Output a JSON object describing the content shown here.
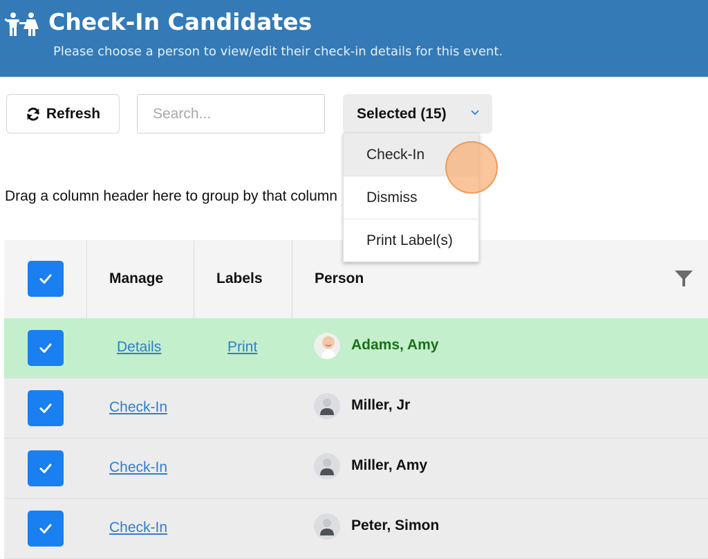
{
  "header": {
    "icon": "people-icon",
    "title": "Check-In Candidates",
    "subtitle": "Please choose a person to view/edit their check-in details for this event."
  },
  "toolbar": {
    "refresh_label": "Refresh",
    "refresh_icon": "refresh-icon",
    "search_placeholder": "Search...",
    "search_value": "",
    "selected_label": "Selected (15)",
    "selected_count": 15
  },
  "dropdown_menu": {
    "items": [
      {
        "label": "Check-In",
        "active": true
      },
      {
        "label": "Dismiss",
        "active": false
      },
      {
        "label": "Print Label(s)",
        "active": false
      }
    ]
  },
  "grid": {
    "group_hint": "Drag a column header here to group by that column",
    "columns": {
      "manage": "Manage",
      "labels": "Labels",
      "person": "Person"
    },
    "select_all_checked": true,
    "rows": [
      {
        "checked": true,
        "manage_link": "Details",
        "labels_link": "Print",
        "name": "Adams, Amy",
        "status": "checked-in",
        "avatar": "photo"
      },
      {
        "checked": true,
        "manage_link": "Check-In",
        "labels_link": "",
        "name": "Miller, Jr",
        "status": "candidate",
        "avatar": "placeholder"
      },
      {
        "checked": true,
        "manage_link": "Check-In",
        "labels_link": "",
        "name": "Miller, Amy",
        "status": "candidate",
        "avatar": "placeholder"
      },
      {
        "checked": true,
        "manage_link": "Check-In",
        "labels_link": "",
        "name": "Peter, Simon",
        "status": "candidate",
        "avatar": "placeholder"
      }
    ]
  },
  "colors": {
    "header_bg": "#337ab7",
    "checkbox": "#1a7ff0",
    "link": "#2f7dcf",
    "checked_in_row": "#c3efcc",
    "checked_in_name": "#1b6e1b"
  }
}
